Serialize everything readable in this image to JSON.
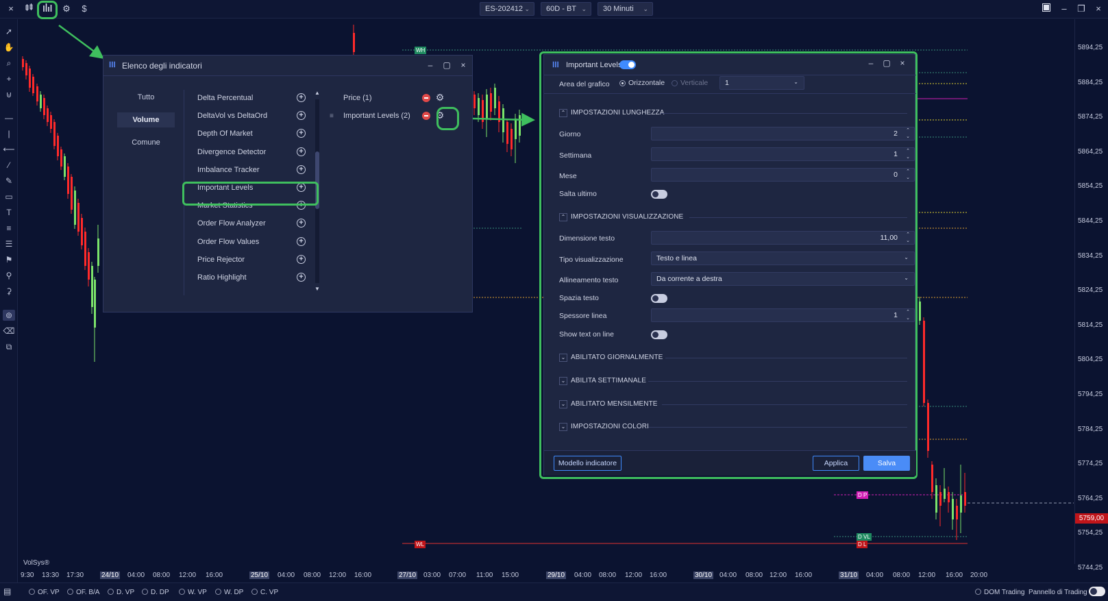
{
  "toolbar": {
    "close_icon": "×",
    "symbol": "ES-202412",
    "range": "60D - BT",
    "timeframe": "30 Minuti"
  },
  "price_axis": [
    "5894,25",
    "5884,25",
    "5874,25",
    "5864,25",
    "5854,25",
    "5844,25",
    "5834,25",
    "5824,25",
    "5814,25",
    "5804,25",
    "5794,25",
    "5784,25",
    "5774,25",
    "5764,25",
    "5754,25",
    "5744,25"
  ],
  "current_price": "5759,00",
  "time_axis": [
    {
      "t": "9:30",
      "hl": false
    },
    {
      "t": "13:30",
      "hl": false
    },
    {
      "t": "17:30",
      "hl": false
    },
    {
      "t": "24/10",
      "hl": true
    },
    {
      "t": "04:00",
      "hl": false
    },
    {
      "t": "08:00",
      "hl": false
    },
    {
      "t": "12:00",
      "hl": false
    },
    {
      "t": "16:00",
      "hl": false
    },
    {
      "t": "25/10",
      "hl": true
    },
    {
      "t": "04:00",
      "hl": false
    },
    {
      "t": "08:00",
      "hl": false
    },
    {
      "t": "12:00",
      "hl": false
    },
    {
      "t": "16:00",
      "hl": false
    },
    {
      "t": "27/10",
      "hl": true
    },
    {
      "t": "03:00",
      "hl": false
    },
    {
      "t": "07:00",
      "hl": false
    },
    {
      "t": "11:00",
      "hl": false
    },
    {
      "t": "15:00",
      "hl": false
    },
    {
      "t": "29/10",
      "hl": true
    },
    {
      "t": "04:00",
      "hl": false
    },
    {
      "t": "08:00",
      "hl": false
    },
    {
      "t": "12:00",
      "hl": false
    },
    {
      "t": "16:00",
      "hl": false
    },
    {
      "t": "30/10",
      "hl": true
    },
    {
      "t": "04:00",
      "hl": false
    },
    {
      "t": "08:00",
      "hl": false
    },
    {
      "t": "12:00",
      "hl": false
    },
    {
      "t": "16:00",
      "hl": false
    },
    {
      "t": "31/10",
      "hl": true
    },
    {
      "t": "04:00",
      "hl": false
    },
    {
      "t": "08:00",
      "hl": false
    },
    {
      "t": "12:00",
      "hl": false
    },
    {
      "t": "16:00",
      "hl": false
    },
    {
      "t": "20:00",
      "hl": false
    }
  ],
  "brand": "VolSys®",
  "level_tags": {
    "wh": "WH",
    "wl": "WL",
    "dp": "D P",
    "dvl": "D VL",
    "dl": "D L"
  },
  "status": {
    "items": [
      "OF. VP",
      "OF. B/A",
      "D. VP",
      "D. DP",
      "W. VP",
      "W. DP",
      "C. VP"
    ],
    "dom_trading": "DOM Trading",
    "panel": "Pannello di Trading"
  },
  "indicator_window": {
    "title": "Elenco degli indicatori",
    "categories": [
      "Tutto",
      "Volume",
      "Comune"
    ],
    "active_category": "Volume",
    "indicators": [
      "Delta Percentual",
      "DeltaVol vs DeltaOrd",
      "Depth Of Market",
      "Divergence Detector",
      "Imbalance Tracker",
      "Important Levels",
      "Market Statistics",
      "Order Flow Analyzer",
      "Order Flow Values",
      "Price Rejector",
      "Ratio Highlight"
    ],
    "active": [
      "Price (1)",
      "Important Levels (2)"
    ]
  },
  "settings_window": {
    "title": "Important Levels",
    "chart_area_label": "Area del grafico",
    "orientation_h": "Orizzontale",
    "orientation_v": "Verticale",
    "area_value": "1",
    "sec_length": "IMPOSTAZIONI LUNGHEZZA",
    "giorno_label": "Giorno",
    "giorno_value": "2",
    "settimana_label": "Settimana",
    "settimana_value": "1",
    "mese_label": "Mese",
    "mese_value": "0",
    "salta_label": "Salta ultimo",
    "sec_display": "IMPOSTAZIONI VISUALIZZAZIONE",
    "dim_label": "Dimensione testo",
    "dim_value": "11,00",
    "tipo_label": "Tipo visualizzazione",
    "tipo_value": "Testo e linea",
    "allin_label": "Allineamento testo",
    "allin_value": "Da corrente a destra",
    "spazia_label": "Spazia testo",
    "spessore_label": "Spessore linea",
    "spessore_value": "1",
    "show_label": "Show text on line",
    "sec_daily": "ABILITATO GIORNALMENTE",
    "sec_weekly": "ABILITA SETTIMANALE",
    "sec_monthly": "ABILITATO MENSILMENTE",
    "sec_colors": "IMPOSTAZIONI COLORI",
    "btn_model": "Modello indicatore",
    "btn_apply": "Applica",
    "btn_save": "Salva"
  },
  "colors": {
    "accent": "#3f8bff",
    "highlight": "#3fbf5e",
    "up": "#7be36a",
    "down": "#ff2a2a"
  }
}
